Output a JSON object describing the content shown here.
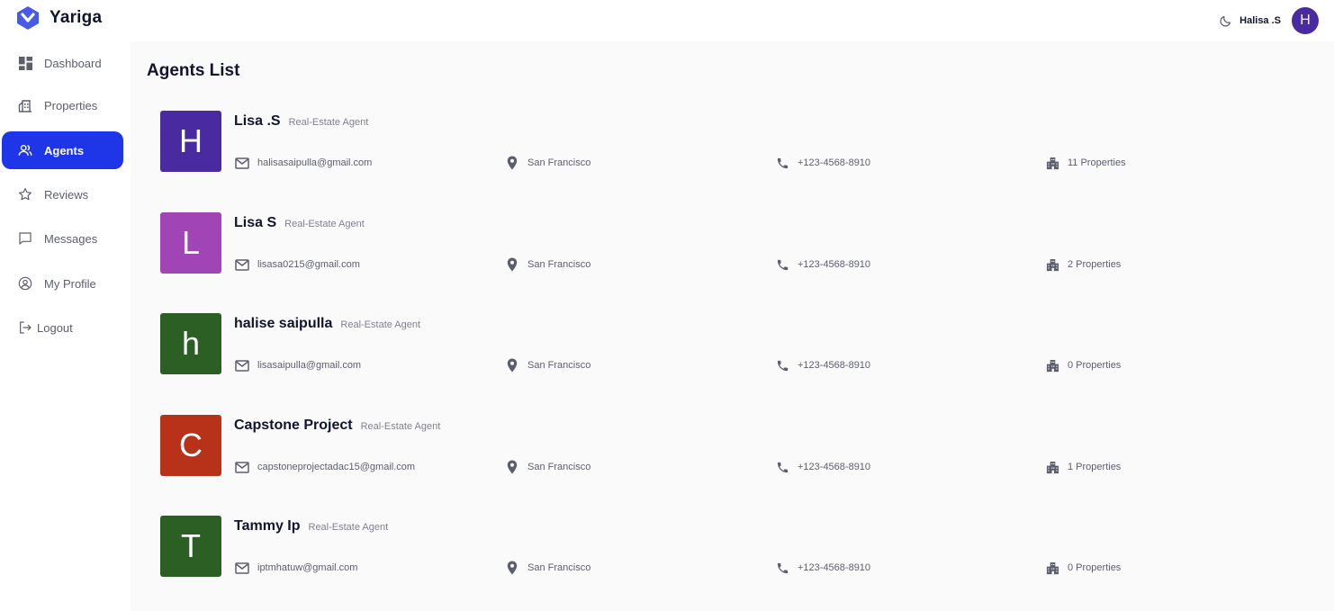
{
  "brand": {
    "name": "Yariga",
    "accent": "#475be8"
  },
  "header": {
    "user_name": "Halisa .S",
    "avatar_initial": "H",
    "avatar_color": "#4a2aa1"
  },
  "sidebar": {
    "items": [
      {
        "label": "Dashboard",
        "icon": "dashboard-icon",
        "active": false
      },
      {
        "label": "Properties",
        "icon": "properties-icon",
        "active": false
      },
      {
        "label": "Agents",
        "icon": "agents-icon",
        "active": true
      },
      {
        "label": "Reviews",
        "icon": "star-icon",
        "active": false
      },
      {
        "label": "Messages",
        "icon": "message-icon",
        "active": false
      },
      {
        "label": "My Profile",
        "icon": "profile-icon",
        "active": false
      }
    ],
    "logout_label": "Logout",
    "active_color": "#1e36e8"
  },
  "main": {
    "title": "Agents List",
    "agents": [
      {
        "initial": "H",
        "color": "#4a2aa1",
        "name": "Lisa .S",
        "role": "Real-Estate Agent",
        "email": "halisasaipulla@gmail.com",
        "location": "San Francisco",
        "phone": "+123-4568-8910",
        "properties": "11 Properties"
      },
      {
        "initial": "L",
        "color": "#a044b6",
        "name": "Lisa S",
        "role": "Real-Estate Agent",
        "email": "lisasa0215@gmail.com",
        "location": "San Francisco",
        "phone": "+123-4568-8910",
        "properties": "2 Properties"
      },
      {
        "initial": "h",
        "color": "#2c5f24",
        "name": "halise saipulla",
        "role": "Real-Estate Agent",
        "email": "lisasaipulla@gmail.com",
        "location": "San Francisco",
        "phone": "+123-4568-8910",
        "properties": "0 Properties"
      },
      {
        "initial": "C",
        "color": "#b8321a",
        "name": "Capstone Project",
        "role": "Real-Estate Agent",
        "email": "capstoneprojectadac15@gmail.com",
        "location": "San Francisco",
        "phone": "+123-4568-8910",
        "properties": "1 Properties"
      },
      {
        "initial": "T",
        "color": "#2c5f24",
        "name": "Tammy Ip",
        "role": "Real-Estate Agent",
        "email": "iptmhatuw@gmail.com",
        "location": "San Francisco",
        "phone": "+123-4568-8910",
        "properties": "0 Properties"
      }
    ]
  }
}
